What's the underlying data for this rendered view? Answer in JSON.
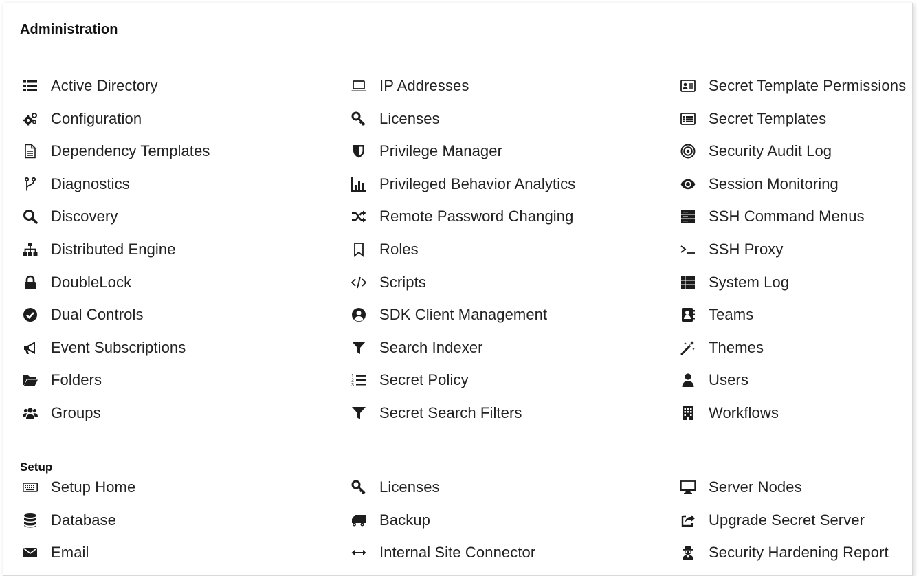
{
  "header": {
    "title": "Administration"
  },
  "admin_columns": [
    [
      {
        "label": "Active Directory",
        "icon": "list-icon"
      },
      {
        "label": "Configuration",
        "icon": "cogs-icon"
      },
      {
        "label": "Dependency Templates",
        "icon": "file-icon"
      },
      {
        "label": "Diagnostics",
        "icon": "branch-icon"
      },
      {
        "label": "Discovery",
        "icon": "search-icon"
      },
      {
        "label": "Distributed Engine",
        "icon": "sitemap-icon"
      },
      {
        "label": "DoubleLock",
        "icon": "lock-icon"
      },
      {
        "label": "Dual Controls",
        "icon": "check-circle-icon"
      },
      {
        "label": "Event Subscriptions",
        "icon": "megaphone-icon"
      },
      {
        "label": "Folders",
        "icon": "folder-open-icon"
      },
      {
        "label": "Groups",
        "icon": "users-icon"
      }
    ],
    [
      {
        "label": "IP Addresses",
        "icon": "laptop-icon"
      },
      {
        "label": "Licenses",
        "icon": "key-icon"
      },
      {
        "label": "Privilege Manager",
        "icon": "shield-icon"
      },
      {
        "label": "Privileged Behavior Analytics",
        "icon": "bar-chart-icon"
      },
      {
        "label": "Remote Password Changing",
        "icon": "shuffle-icon"
      },
      {
        "label": "Roles",
        "icon": "bookmark-icon"
      },
      {
        "label": "Scripts",
        "icon": "code-icon"
      },
      {
        "label": "SDK Client Management",
        "icon": "user-circle-icon"
      },
      {
        "label": "Search Indexer",
        "icon": "filter-icon"
      },
      {
        "label": "Secret Policy",
        "icon": "numbered-list-icon"
      },
      {
        "label": "Secret Search Filters",
        "icon": "filter-icon"
      }
    ],
    [
      {
        "label": "Secret Template Permissions",
        "icon": "id-card-icon"
      },
      {
        "label": "Secret Templates",
        "icon": "list-alt-icon"
      },
      {
        "label": "Security Audit Log",
        "icon": "bullseye-icon"
      },
      {
        "label": "Session Monitoring",
        "icon": "eye-icon"
      },
      {
        "label": "SSH Command Menus",
        "icon": "server-icon"
      },
      {
        "label": "SSH Proxy",
        "icon": "terminal-icon"
      },
      {
        "label": "System Log",
        "icon": "th-list-icon"
      },
      {
        "label": "Teams",
        "icon": "address-book-icon"
      },
      {
        "label": "Themes",
        "icon": "magic-wand-icon"
      },
      {
        "label": "Users",
        "icon": "user-icon"
      },
      {
        "label": "Workflows",
        "icon": "building-icon"
      }
    ]
  ],
  "setup": {
    "title": "Setup",
    "columns": [
      [
        {
          "label": "Setup Home",
          "icon": "keyboard-icon"
        },
        {
          "label": "Database",
          "icon": "database-icon"
        },
        {
          "label": "Email",
          "icon": "envelope-icon"
        }
      ],
      [
        {
          "label": "Licenses",
          "icon": "key-icon"
        },
        {
          "label": "Backup",
          "icon": "truck-icon"
        },
        {
          "label": "Internal Site Connector",
          "icon": "arrows-h-icon"
        }
      ],
      [
        {
          "label": "Server Nodes",
          "icon": "desktop-icon"
        },
        {
          "label": "Upgrade Secret Server",
          "icon": "share-icon"
        },
        {
          "label": "Security Hardening Report",
          "icon": "user-secret-icon"
        }
      ]
    ]
  }
}
